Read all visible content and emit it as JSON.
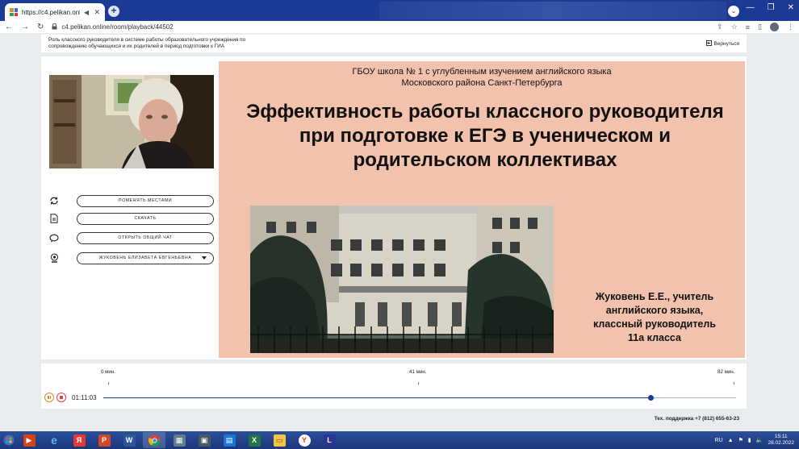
{
  "browser": {
    "tab_title": "https://c4.pelikan.online/roo",
    "url": "c4.pelikan.online/room/playback/44502"
  },
  "page": {
    "title": "Роль классного руководителя в системе работы образовательного учреждения по сопровождению обучающихся и их родителей в период подготовки к ГИА",
    "back_label": "Вернуться"
  },
  "sidebar": {
    "actions": [
      {
        "label": "Поменять местами",
        "icon": "swap-icon"
      },
      {
        "label": "Скачать",
        "icon": "document-icon"
      },
      {
        "label": "Открыть общий чат",
        "icon": "chat-icon"
      },
      {
        "label": "Жуковень Елизавета Евгеньевна",
        "icon": "webcam-icon"
      }
    ]
  },
  "slide": {
    "school_line1": "ГБОУ школа № 1 с углубленным изучением английского языка",
    "school_line2": "Московского района Санкт-Петербурга",
    "headline": "Эффективность работы классного руководителя при подготовке к ЕГЭ в ученическом и родительском коллективах",
    "author_line1": "Жуковень Е.Е., учитель",
    "author_line2": "английского языка,",
    "author_line3": "классный руководитель",
    "author_line4": "11а класса"
  },
  "player": {
    "tick_start": "0 мин.",
    "tick_mid": "41 мин.",
    "tick_end": "82 мин.",
    "current_time": "01:11:03",
    "progress_fraction": 0.865
  },
  "footer": {
    "support": "Тех. поддержка +7 (812) 655-63-23"
  },
  "taskbar": {
    "lang": "RU",
    "time": "15:11",
    "date": "28.02.2022"
  },
  "colors": {
    "slide_bg": "#f2c2ad",
    "progress": "#1c3c94",
    "titlebar": "#1a3a93"
  }
}
